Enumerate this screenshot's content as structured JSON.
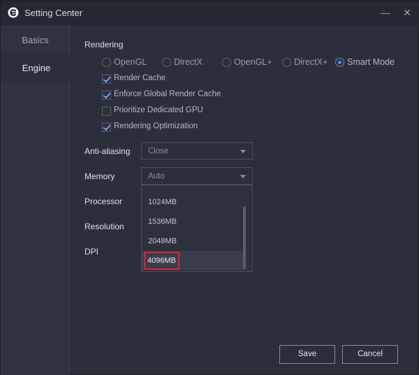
{
  "window": {
    "title": "Setting Center",
    "minimize_label": "—",
    "close_label": "✕"
  },
  "sidebar": {
    "items": [
      {
        "label": "Basics"
      },
      {
        "label": "Engine"
      }
    ],
    "active": "Engine"
  },
  "rendering": {
    "title": "Rendering",
    "modes": [
      {
        "label": "OpenGL",
        "checked": false
      },
      {
        "label": "DirectX",
        "checked": false
      },
      {
        "label": "OpenGL+",
        "checked": false
      },
      {
        "label": "DirectX+",
        "checked": false
      },
      {
        "label": "Smart Mode",
        "checked": true
      }
    ],
    "options": [
      {
        "label": "Render Cache",
        "checked": true
      },
      {
        "label": "Enforce Global Render Cache",
        "checked": true
      },
      {
        "label": "Prioritize Dedicated GPU",
        "checked": false
      },
      {
        "label": "Rendering Optimization",
        "checked": true
      }
    ]
  },
  "anti_aliasing": {
    "label": "Anti-aliasing",
    "value": "Close"
  },
  "memory": {
    "label": "Memory",
    "value": "Auto",
    "options": [
      "1024MB",
      "1536MB",
      "2048MB",
      "4096MB"
    ],
    "highlighted": "4096MB"
  },
  "processor": {
    "label": "Processor"
  },
  "resolution": {
    "label": "Resolution"
  },
  "dpi": {
    "label": "DPI"
  },
  "footer": {
    "save_label": "Save",
    "cancel_label": "Cancel"
  },
  "colors": {
    "accent": "#3f8cff",
    "highlight_border": "#e0232f",
    "background": "#2b2e3b"
  }
}
